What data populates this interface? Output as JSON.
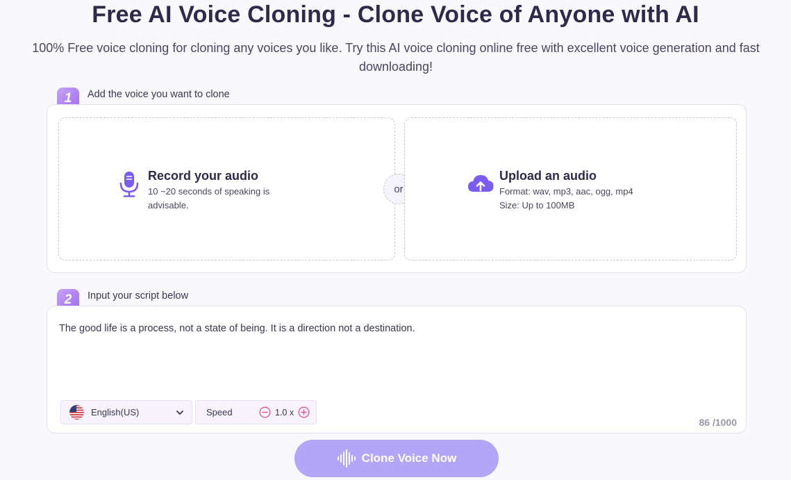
{
  "header": {
    "title": "Free AI Voice Cloning - Clone Voice of Anyone with AI",
    "subtitle": "100% Free voice cloning for cloning any voices you like. Try this AI voice cloning online free with excellent voice generation and fast downloading!"
  },
  "step1": {
    "number": "1",
    "label": "Add the voice you want to clone",
    "record": {
      "title": "Record your audio",
      "description": "10 ~20 seconds of speaking is advisable.",
      "icon": "microphone-icon"
    },
    "or_text": "or",
    "upload": {
      "title": "Upload an audio",
      "format": "Format: wav, mp3, aac, ogg, mp4",
      "size": "Size: Up to 100MB",
      "icon": "cloud-upload-icon"
    }
  },
  "step2": {
    "number": "2",
    "label": "Input your script below",
    "script": "The good life is a process, not a state of being. It is a direction not a destination.",
    "language": "English(US)",
    "speed_label": "Speed",
    "speed_value": "1.0 x",
    "counter": "86 /1000"
  },
  "action": {
    "clone_label": "Clone Voice Now"
  },
  "colors": {
    "accent": "#7b5cf0",
    "button": "#b3a6f6",
    "badge_start": "#c9a3f7",
    "badge_end": "#9c6cf0",
    "speed_icon": "#e0529c"
  }
}
